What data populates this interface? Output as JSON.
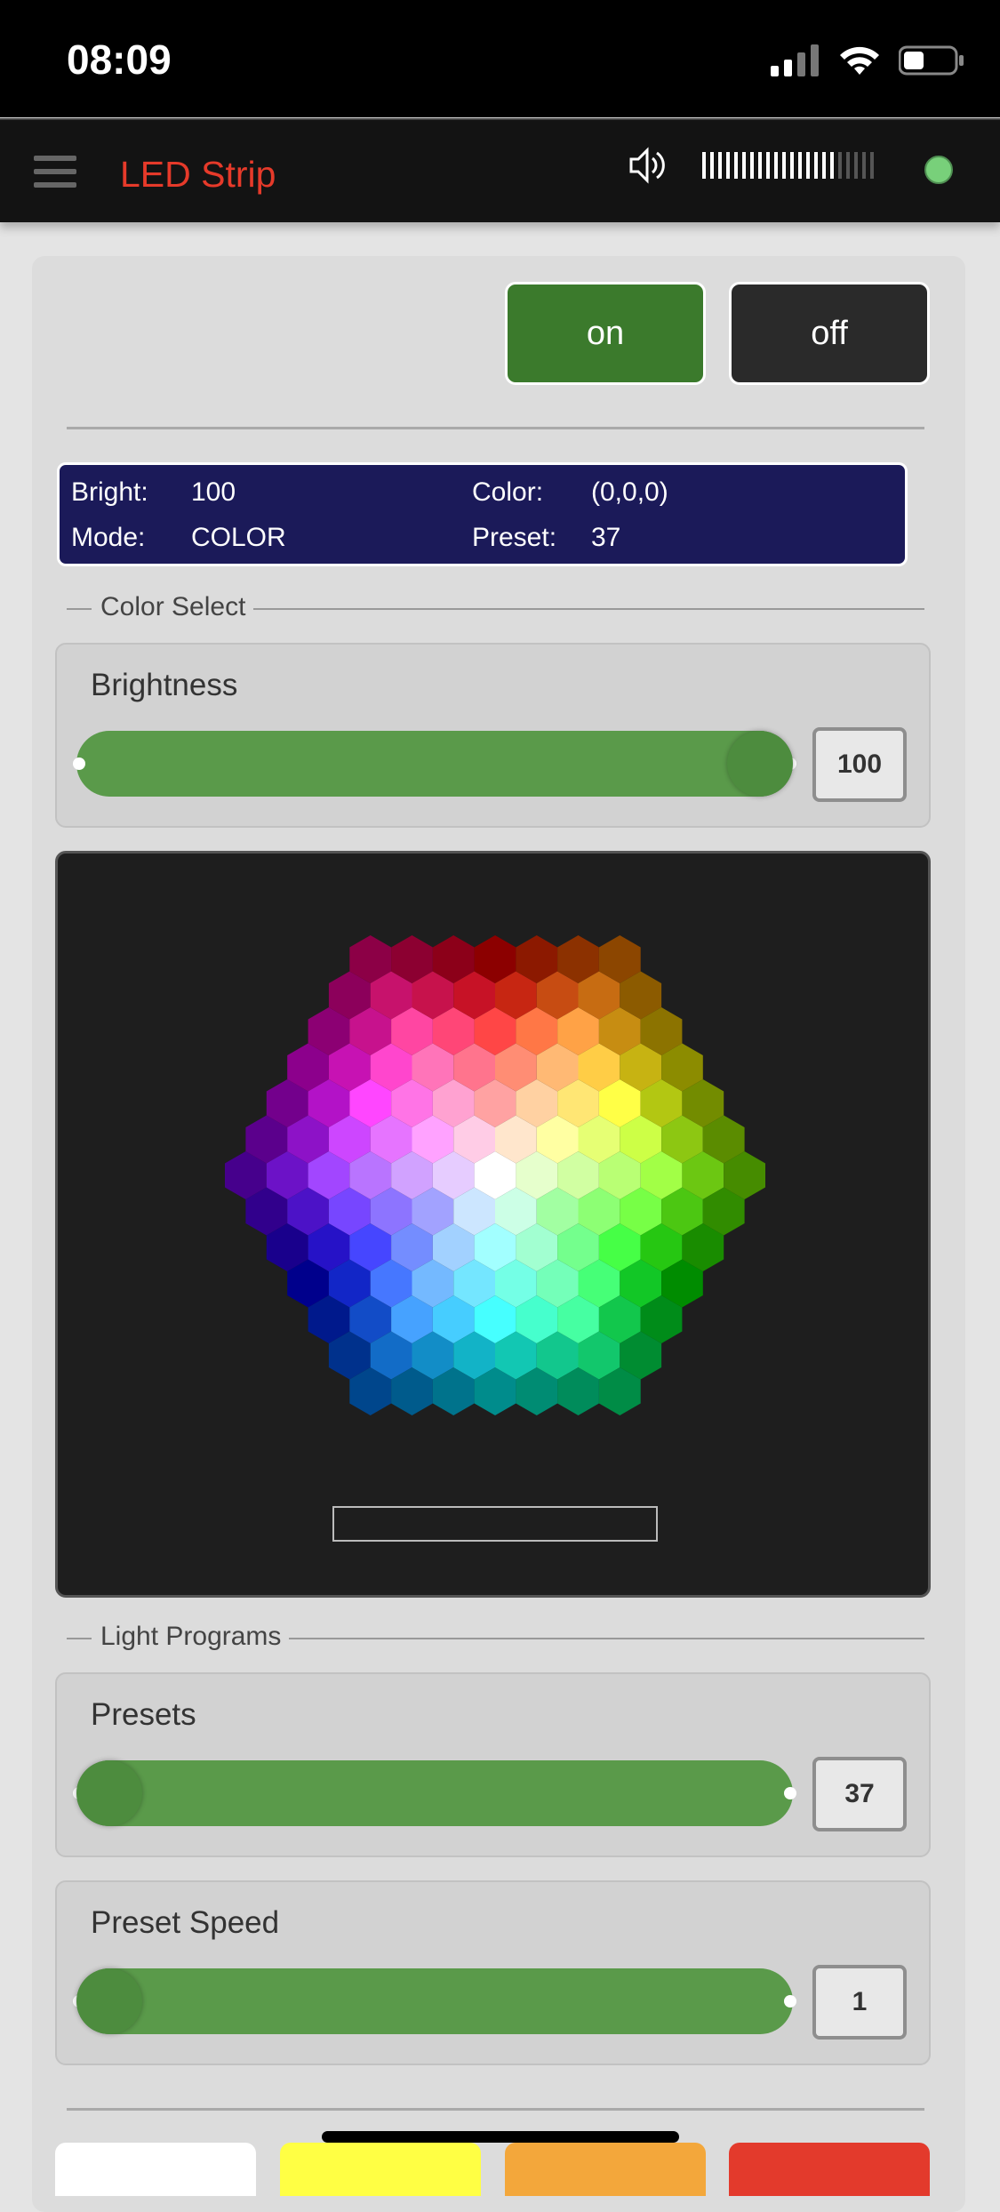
{
  "status_bar": {
    "time": "08:09",
    "icons": [
      "signal-icon",
      "wifi-icon",
      "battery-icon"
    ]
  },
  "header": {
    "title": "LED Strip",
    "title_color": "#e63a2a",
    "menu_icon": "hamburger-icon",
    "speaker_icon": "speaker-icon",
    "volume_level": 0.78,
    "connection_status_color": "#78d07a"
  },
  "power": {
    "on_label": "on",
    "off_label": "off"
  },
  "info": {
    "bright_label": "Bright:",
    "bright_value": "100",
    "mode_label": "Mode:",
    "mode_value": "COLOR",
    "color_label": "Color:",
    "color_value": "(0,0,0)",
    "preset_label": "Preset:",
    "preset_value": "37"
  },
  "color_select": {
    "legend": "Color Select",
    "brightness_label": "Brightness",
    "brightness_value": "100",
    "brightness_fraction": 1.0,
    "hex_input_value": ""
  },
  "light_programs": {
    "legend": "Light Programs",
    "presets_label": "Presets",
    "presets_value": "37",
    "presets_fraction": 0.0,
    "speed_label": "Preset Speed",
    "speed_value": "1",
    "speed_fraction": 0.0
  },
  "color_swatches": [
    "#ffffff",
    "#ffff44",
    "#f3a73b",
    "#e33a2c"
  ],
  "colors": {
    "accent_green": "#3b7a2c",
    "slider_green": "#5a9a4a",
    "info_bg": "#1b1a59"
  }
}
